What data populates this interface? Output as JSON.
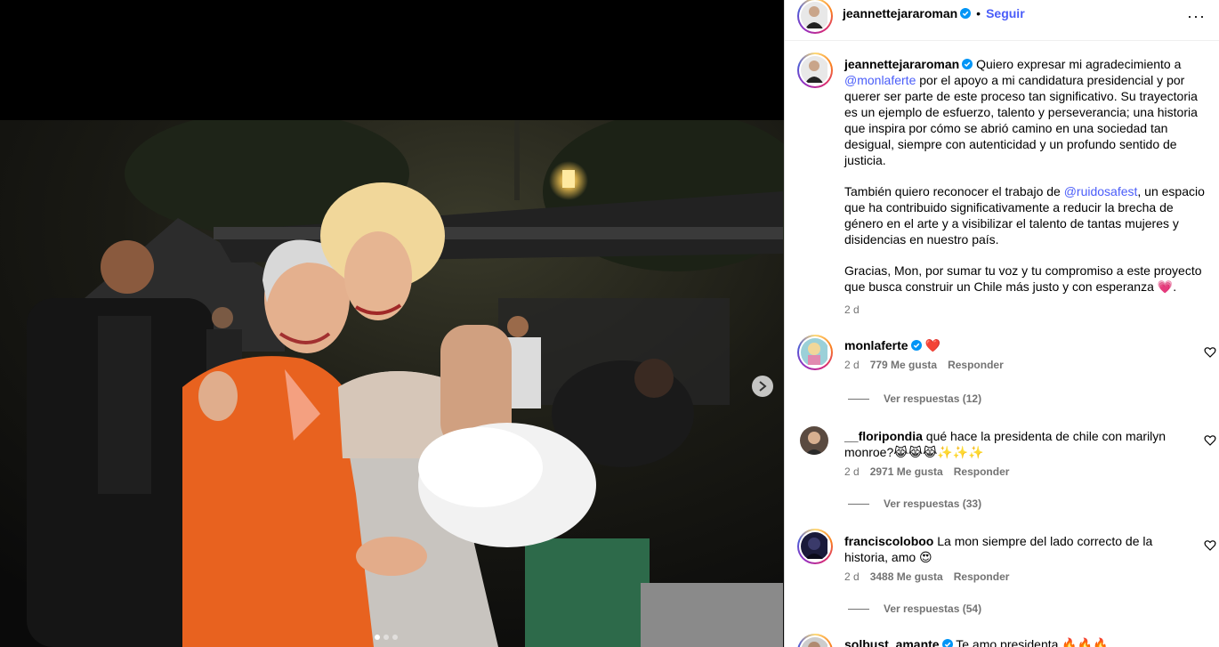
{
  "post": {
    "author": "jeannettejararoman",
    "follow_label": "Seguir",
    "more_label": "···",
    "caption_p1_a": "Quiero expresar mi agradecimiento a ",
    "caption_p1_mention": "@monlaferte",
    "caption_p1_b": " por el apoyo a mi candidatura presidencial y por querer ser parte de este proceso tan significativo. Su trayectoria es un ejemplo de esfuerzo, talento y perseverancia; una historia que inspira por cómo se abrió camino en una sociedad tan desigual, siempre con autenticidad y un profundo sentido de justicia.",
    "caption_p2_a": "También quiero reconocer el trabajo de ",
    "caption_p2_mention": "@ruidosafest",
    "caption_p2_b": ", un espacio que ha contribuido significativamente a reducir la brecha de género en el arte y a visibilizar el talento de tantas mujeres y disidencias en nuestro país.",
    "caption_p3": "Gracias, Mon, por sumar tu voz y tu compromiso a este proyecto que busca construir un Chile más justo y con esperanza ",
    "caption_p3_emoji": "💗",
    "caption_p3_end": ".",
    "time": "2 d"
  },
  "comments": [
    {
      "user": "monlaferte",
      "verified": true,
      "text": "❤️",
      "time": "2 d",
      "likes": "779 Me gusta",
      "reply": "Responder",
      "replies": "Ver respuestas (12)"
    },
    {
      "user": "__floripondia",
      "verified": false,
      "text": "qué hace la presidenta de chile con marilyn monroe?😹😹😹✨✨✨",
      "time": "2 d",
      "likes": "2971 Me gusta",
      "reply": "Responder",
      "replies": "Ver respuestas (33)"
    },
    {
      "user": "franciscoloboo",
      "verified": false,
      "text": "La mon siempre del lado correcto de la historia, amo 😍",
      "time": "2 d",
      "likes": "3488 Me gusta",
      "reply": "Responder",
      "replies": "Ver respuestas (54)"
    },
    {
      "user": "solbust_amante",
      "verified": true,
      "text": "Te amo presidenta 🔥🔥🔥",
      "time": "",
      "likes": "",
      "reply": "",
      "replies": ""
    }
  ],
  "colors": {
    "accent": "#4a5df9",
    "verified": "#0095f6",
    "heart": "#ff3040"
  }
}
